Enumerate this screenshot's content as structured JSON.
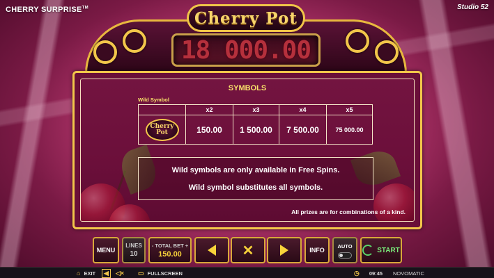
{
  "game": {
    "title": "CHERRY SURPRISE",
    "trademark": "TM",
    "studio": "Studio 52"
  },
  "header": {
    "logo": "Cherry Pot",
    "jackpot": "18 000.00"
  },
  "paytable": {
    "title": "SYMBOLS",
    "wild_label": "Wild Symbol",
    "wild_icon_text": "Cherry Pot",
    "columns": [
      "x2",
      "x3",
      "x4",
      "x5"
    ],
    "values": [
      "150.00",
      "1 500.00",
      "7 500.00",
      "75 000.00"
    ],
    "info_lines": [
      "Wild symbols are only available in Free Spins.",
      "Wild symbol substitutes all symbols."
    ],
    "footnote": "All prizes are for combinations of a kind."
  },
  "controls": {
    "menu": "MENU",
    "lines_label": "LINES",
    "lines_value": "10",
    "total_bet_label": "TOTAL BET",
    "total_bet_minus": "-",
    "total_bet_plus": "+",
    "total_bet_value": "150.00",
    "info": "INFO",
    "auto": "AUTO",
    "start": "START"
  },
  "statusbar": {
    "exit": "EXIT",
    "fullscreen": "FULLSCREEN",
    "time": "09:45",
    "brand": "NOVOMATIC"
  },
  "colors": {
    "gold": "#f2c64a",
    "panel": "#6a0f38",
    "title_yellow": "#f8e06a",
    "start_green": "#7aea7a"
  }
}
